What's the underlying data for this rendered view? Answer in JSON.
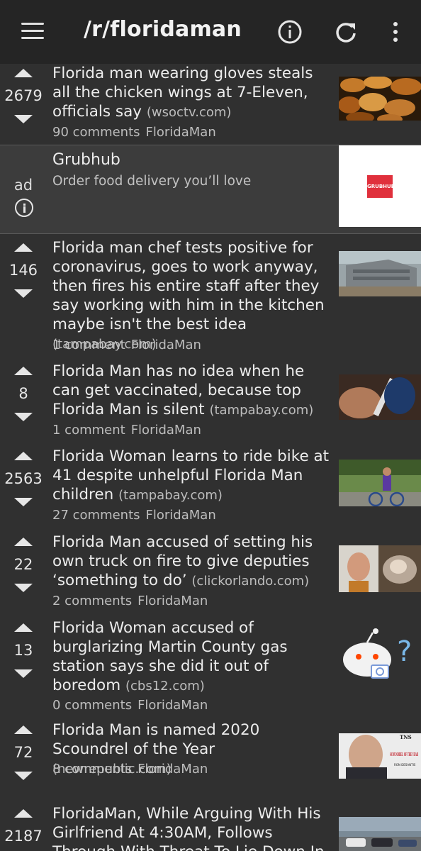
{
  "app": {
    "title": "/r/floridaman"
  },
  "toolbar": {
    "menu_icon": "hamburger-menu-icon",
    "info_icon": "info-icon",
    "refresh_icon": "refresh-icon",
    "more_icon": "more-vertical-icon"
  },
  "posts": [
    {
      "score": "2679",
      "title": "Florida man wearing gloves steals all the chicken wings at 7-Eleven, officials say",
      "domain": "(wsoctv.com)",
      "comments": "90 comments",
      "subreddit": "FloridaMan"
    },
    {
      "score": "146",
      "title": "Florida man chef tests positive for coronavirus, goes to work anyway, then fires his entire staff after they say working with him in the kitchen maybe isn't the best idea",
      "domain": "(tampabay.com)",
      "comments": "1 comment",
      "subreddit": "FloridaMan"
    },
    {
      "score": "8",
      "title": "Florida Man has no idea when he can get vaccinated, because top Florida Man is silent",
      "domain": "(tampabay.com)",
      "comments": "1 comment",
      "subreddit": "FloridaMan"
    },
    {
      "score": "2563",
      "title": "Florida Woman learns to ride bike at 41 despite unhelpful Florida Man children",
      "domain": "(tampabay.com)",
      "comments": "27 comments",
      "subreddit": "FloridaMan"
    },
    {
      "score": "22",
      "title": "Florida Man accused of setting his own truck on fire to give deputies ‘something to do’",
      "domain": "(clickorlando.com)",
      "comments": "2 comments",
      "subreddit": "FloridaMan"
    },
    {
      "score": "13",
      "title": "Florida Woman accused of burglarizing Martin County gas station says she did it out of boredom",
      "domain": "(cbs12.com)",
      "comments": "0 comments",
      "subreddit": "FloridaMan"
    },
    {
      "score": "72",
      "title": "Florida Man is named 2020 Scoundrel of the Year",
      "domain": "(newrepublic.com)",
      "comments": "8 comments",
      "subreddit": "FloridaMan"
    },
    {
      "score": "2187",
      "title": "FloridaMan, While Arguing With His Girlfriend At 4:30AM, Follows Through With Threat To Lie Down In The Middle",
      "domain": "",
      "comments": "",
      "subreddit": ""
    }
  ],
  "ad": {
    "label": "ad",
    "title": "Grubhub",
    "subtitle": "Order food delivery you’ll love",
    "logo_text": "GRUBHUB",
    "info_icon": "info-icon"
  },
  "thumbs": {
    "scoundrel_tns": "TNS",
    "scoundrel_text": "SCOUNDREL OF THE YEAR",
    "scoundrel_name": "RON DESANTIS",
    "question_mark": "?"
  },
  "colors": {
    "background": "#303030",
    "topbar": "#252525",
    "ad_background": "#3c3c3c",
    "text": "#ececec",
    "muted": "#bdbdbd",
    "grubhub_red": "#e0303c"
  }
}
